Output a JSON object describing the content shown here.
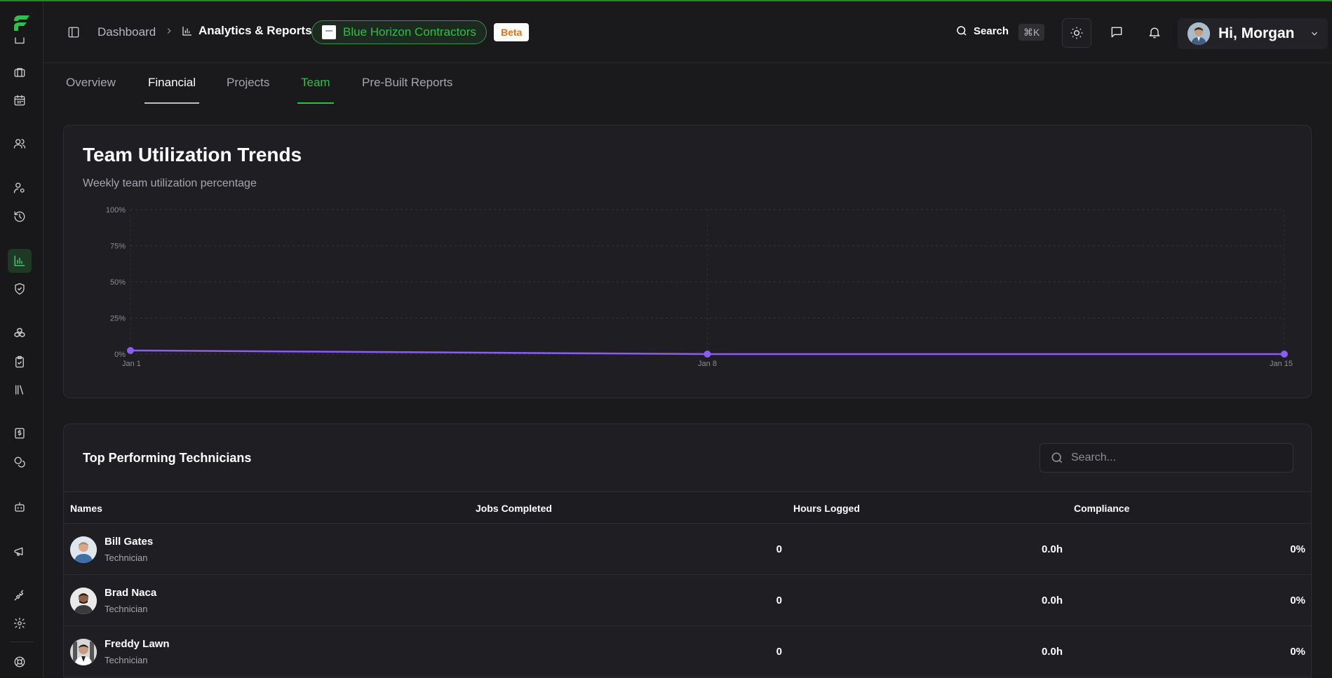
{
  "breadcrumb": {
    "root": "Dashboard",
    "current": "Analytics & Reports"
  },
  "company": {
    "name": "Blue Horizon Contractors",
    "badge": "Beta"
  },
  "header": {
    "search_label": "Search",
    "search_shortcut": "⌘K",
    "greeting": "Hi, Morgan"
  },
  "tabs": [
    {
      "label": "Overview"
    },
    {
      "label": "Financial"
    },
    {
      "label": "Projects"
    },
    {
      "label": "Team",
      "active": true
    },
    {
      "label": "Pre-Built Reports"
    }
  ],
  "chart_card": {
    "title": "Team Utilization Trends",
    "subtitle": "Weekly team utilization percentage"
  },
  "chart_data": {
    "type": "line",
    "title": "Team Utilization Trends",
    "x": [
      "Jan 1",
      "Jan 8",
      "Jan 15"
    ],
    "series": [
      {
        "values": [
          2.5,
          0,
          0
        ],
        "color": "#8b5cf6"
      }
    ],
    "ylim": [
      0,
      100
    ],
    "yticks": [
      "100%",
      "75%",
      "50%",
      "25%",
      "0%"
    ],
    "ytick_values": [
      100,
      75,
      50,
      25,
      0
    ],
    "grid": true
  },
  "table": {
    "title": "Top Performing Technicians",
    "search_placeholder": "Search...",
    "columns": [
      "Names",
      "Jobs Completed",
      "Hours Logged",
      "Compliance"
    ],
    "rows": [
      {
        "name": "Bill Gates",
        "role": "Technician",
        "jobs": "0",
        "hours": "0.0h",
        "compliance": "0%"
      },
      {
        "name": "Brad Naca",
        "role": "Technician",
        "jobs": "0",
        "hours": "0.0h",
        "compliance": "0%"
      },
      {
        "name": "Freddy Lawn",
        "role": "Technician",
        "jobs": "0",
        "hours": "0.0h",
        "compliance": "0%"
      }
    ]
  },
  "colors": {
    "accent": "#2fbf4a",
    "line": "#8b5cf6",
    "beta": "#e8711a"
  }
}
